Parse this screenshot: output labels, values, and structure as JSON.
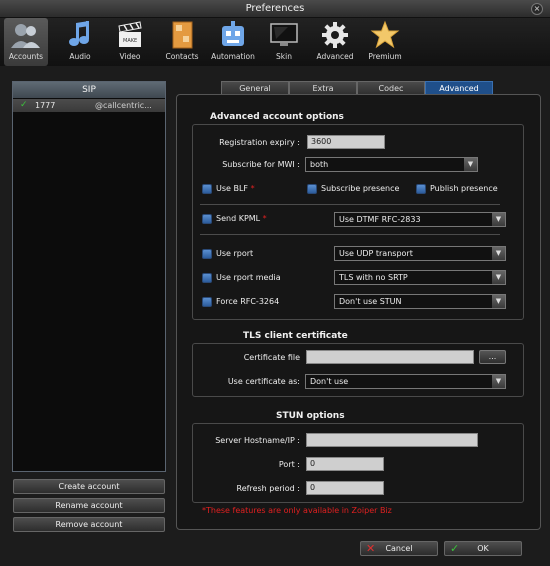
{
  "window": {
    "title": "Preferences",
    "close_glyph": "×"
  },
  "toolbar": {
    "items": [
      {
        "label": "Accounts",
        "icon": "accounts-icon",
        "active": true
      },
      {
        "label": "Audio",
        "icon": "music-note-icon"
      },
      {
        "label": "Video",
        "icon": "clapperboard-icon"
      },
      {
        "label": "Contacts",
        "icon": "address-book-icon"
      },
      {
        "label": "Automation",
        "icon": "robot-icon"
      },
      {
        "label": "Skin",
        "icon": "monitor-icon"
      },
      {
        "label": "Advanced",
        "icon": "gear-icon"
      },
      {
        "label": "Premium",
        "icon": "star-icon"
      }
    ]
  },
  "accounts_panel": {
    "header": "SIP",
    "accounts": [
      {
        "check": "✓",
        "name": "1777",
        "domain": "@callcentric..."
      }
    ],
    "buttons": {
      "create": "Create account",
      "rename": "Rename account",
      "remove": "Remove account"
    }
  },
  "tabs": [
    {
      "label": "General"
    },
    {
      "label": "Extra"
    },
    {
      "label": "Codec"
    },
    {
      "label": "Advanced",
      "active": true
    }
  ],
  "advanced": {
    "title": "Advanced account options",
    "registration_expiry": {
      "label": "Registration expiry :",
      "value": "3600"
    },
    "subscribe_mwi": {
      "label": "Subscribe for MWI :",
      "value": "both"
    },
    "use_blf": {
      "label": "Use BLF",
      "star": "*"
    },
    "subscribe_presence": {
      "label": "Subscribe presence"
    },
    "publish_presence": {
      "label": "Publish presence"
    },
    "send_kpml": {
      "label": "Send KPML",
      "star": "*",
      "select": "Use DTMF RFC-2833"
    },
    "use_rport": {
      "label": "Use rport",
      "select": "Use UDP transport"
    },
    "use_rport_media": {
      "label": "Use rport media",
      "select": "TLS with no SRTP"
    },
    "force_rfc": {
      "label": "Force RFC-3264",
      "select": "Don't use STUN"
    }
  },
  "tls": {
    "title": "TLS client certificate",
    "certificate_file": {
      "label": "Certificate file",
      "value": "",
      "browse": "..."
    },
    "use_certificate": {
      "label": "Use certificate as:",
      "value": "Don't use"
    }
  },
  "stun": {
    "title": "STUN options",
    "server": {
      "label": "Server Hostname/IP :",
      "value": ""
    },
    "port": {
      "label": "Port :",
      "value": "0"
    },
    "refresh": {
      "label": "Refresh period :",
      "value": "0"
    }
  },
  "footnote": "*These features are only available in Zoiper Biz",
  "footer": {
    "cancel": "Cancel",
    "ok": "OK"
  },
  "colors": {
    "accent": "#1f4f8a",
    "checkbox": "#3d74bd",
    "warning": "#e02020",
    "ok_check": "#3cc23c",
    "cancel_x": "#e03030"
  }
}
